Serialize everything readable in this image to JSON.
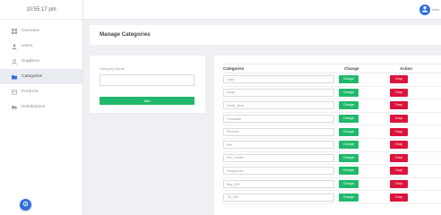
{
  "sidebar": {
    "clock": "10:55:17 pm",
    "items": [
      {
        "label": "Overview",
        "icon": "grid-icon"
      },
      {
        "label": "Users",
        "icon": "user-icon"
      },
      {
        "label": "Suppliers",
        "icon": "supplier-icon"
      },
      {
        "label": "Categories",
        "icon": "folder-icon",
        "active": true
      },
      {
        "label": "Products",
        "icon": "box-icon"
      },
      {
        "label": "Distributions",
        "icon": "truck-icon"
      }
    ],
    "fab_icon": "settings-icon"
  },
  "topbar": {
    "user_icon": "user-avatar-icon",
    "user_name": "adm"
  },
  "header": {
    "title": "Manage Categories"
  },
  "form": {
    "label": "Category Name",
    "input_value": "",
    "input_placeholder": "",
    "add_label": "Add"
  },
  "table": {
    "headers": [
      "Categories",
      "Change",
      "Action"
    ],
    "rows": [
      {
        "name": "Cake",
        "change": "Change",
        "drop": "Drop"
      },
      {
        "name": "Mugs",
        "change": "Change",
        "drop": "Drop"
      },
      {
        "name": "Teddy_Bear",
        "change": "Change",
        "drop": "Drop"
      },
      {
        "name": "Chocolate",
        "change": "Change",
        "drop": "Drop"
      },
      {
        "name": "Perfume",
        "change": "Change",
        "drop": "Drop"
      },
      {
        "name": "Pen",
        "change": "Change",
        "drop": "Drop"
      },
      {
        "name": "Pen_Holder",
        "change": "Change",
        "drop": "Drop"
      },
      {
        "name": "Sunglasses",
        "change": "Change",
        "drop": "Drop"
      },
      {
        "name": "Bag_Gift",
        "change": "Change",
        "drop": "Drop"
      },
      {
        "name": "Tie_Gift",
        "change": "Change",
        "drop": "Drop"
      }
    ]
  },
  "colors": {
    "accent": "#2f6fe0",
    "success": "#20b96b",
    "danger": "#dc143c"
  }
}
